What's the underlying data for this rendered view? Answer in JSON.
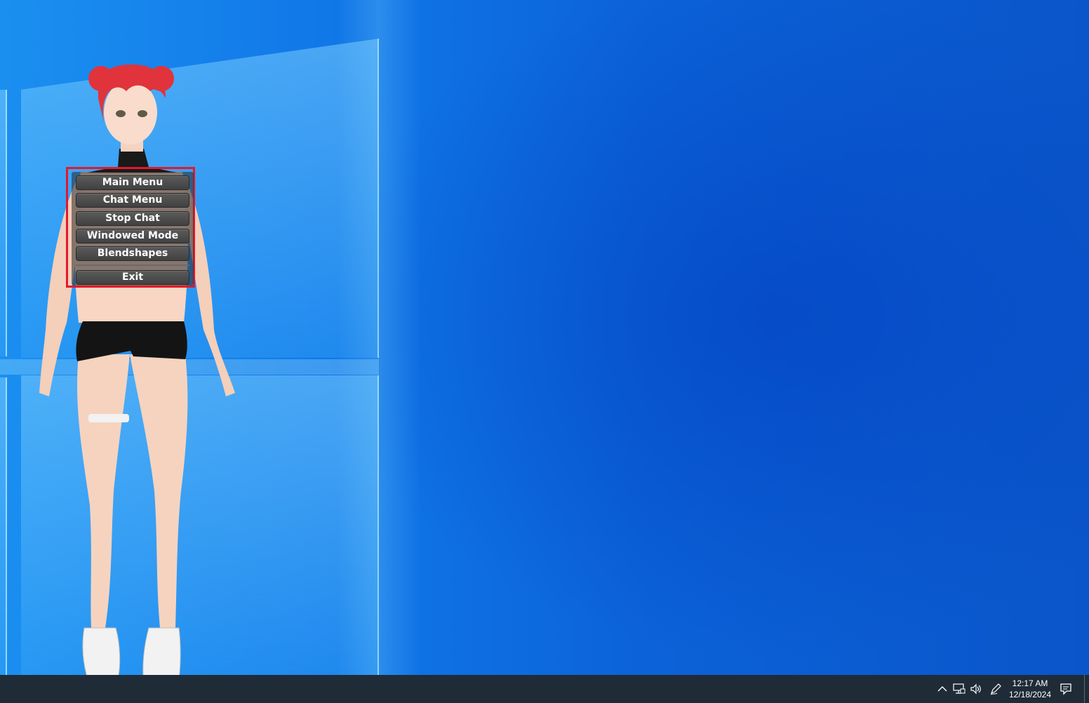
{
  "context_menu": {
    "items": [
      "Main Menu",
      "Chat Menu",
      "Stop Chat",
      "Windowed Mode",
      "Blendshapes"
    ],
    "exit_label": "Exit",
    "highlight_color": "#e2192c"
  },
  "taskbar": {
    "tray_icons": [
      "chevron-up-icon",
      "network-icon",
      "volume-icon",
      "pen-icon",
      "notification-icon"
    ],
    "time": "12:17 AM",
    "date": "12/18/2024"
  },
  "colors": {
    "taskbar_bg": "#1f2b37",
    "desktop_blue": "#0a63d8",
    "hair": "#e1333b"
  }
}
